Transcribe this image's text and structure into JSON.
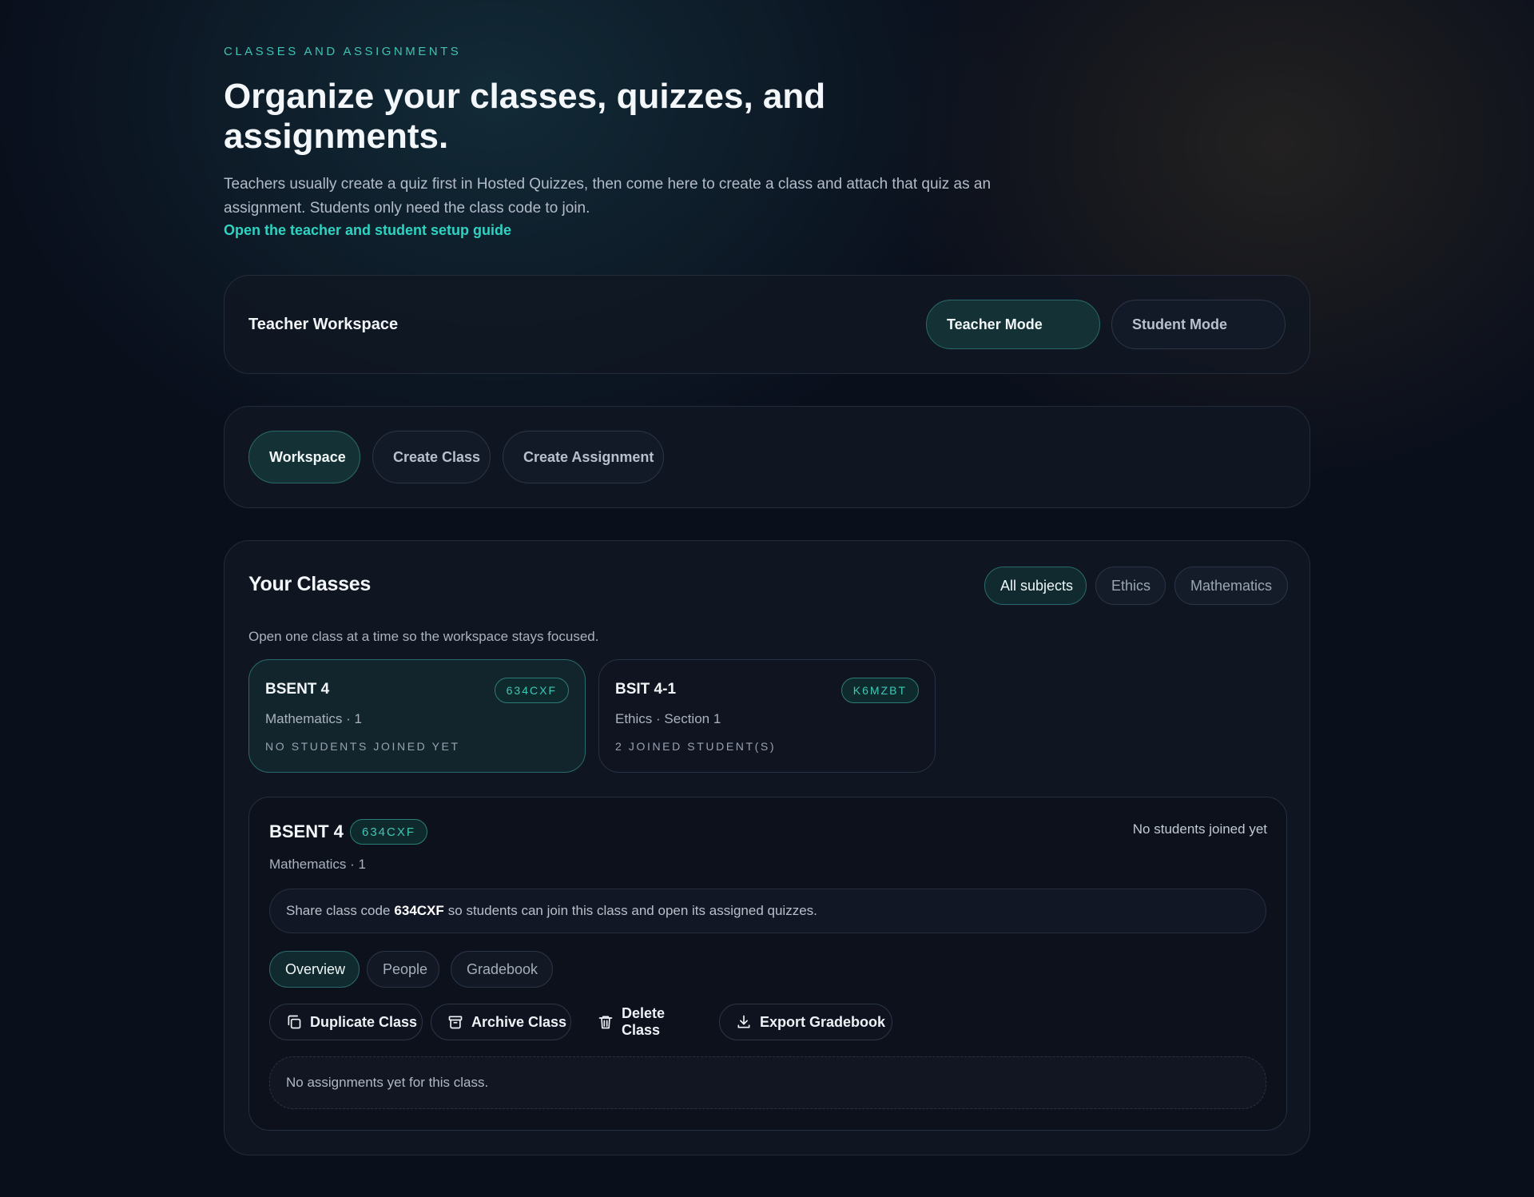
{
  "header": {
    "eyebrow": "CLASSES AND ASSIGNMENTS",
    "title": "Organize your classes, quizzes, and assignments.",
    "intro": "Teachers usually create a quiz first in Hosted Quizzes, then come here to create a class and attach that quiz as an assignment. Students only need the class code to join.",
    "guide_link": "Open the teacher and student setup guide"
  },
  "mode_panel": {
    "title": "Teacher Workspace",
    "modes": [
      "Teacher Mode",
      "Student Mode"
    ],
    "active_mode": "Teacher Mode"
  },
  "nav": {
    "items": [
      "Workspace",
      "Create Class",
      "Create Assignment"
    ],
    "active": "Workspace"
  },
  "classes": {
    "title": "Your Classes",
    "filters": [
      "All subjects",
      "Ethics",
      "Mathematics"
    ],
    "active_filter": "All subjects",
    "hint": "Open one class at a time so the workspace stays focused.",
    "cards": [
      {
        "name": "BSENT 4",
        "code": "634CXF",
        "subtitle": "Mathematics · 1",
        "status": "NO STUDENTS JOINED YET",
        "selected": true
      },
      {
        "name": "BSIT 4-1",
        "code": "K6MZBT",
        "subtitle": "Ethics · Section 1",
        "status": "2 JOINED STUDENT(S)",
        "selected": false
      }
    ]
  },
  "detail": {
    "name": "BSENT 4",
    "code": "634CXF",
    "subtitle": "Mathematics · 1",
    "status": "No students joined yet",
    "share_prefix": "Share class code",
    "share_code": "634CXF",
    "share_suffix": "so students can join this class and open its assigned quizzes.",
    "tabs": [
      "Overview",
      "People",
      "Gradebook"
    ],
    "active_tab": "Overview",
    "actions": [
      {
        "label": "Duplicate Class",
        "icon": "copy-icon"
      },
      {
        "label": "Archive Class",
        "icon": "archive-icon"
      },
      {
        "label": "Delete Class",
        "icon": "trash-icon"
      },
      {
        "label": "Export Gradebook",
        "icon": "download-icon"
      }
    ],
    "empty_text": "No assignments yet for this class."
  },
  "colors": {
    "accent": "#2fd3c1",
    "background": "#0a0f1c",
    "active_pill": "#143236"
  }
}
